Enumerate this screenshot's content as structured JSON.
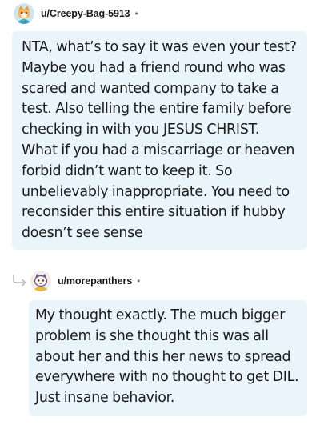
{
  "comments": [
    {
      "username": "u/Creepy-Bag-5913",
      "separator": "•",
      "avatar_icon": "avatar-fox-icon",
      "body": "NTA, what’s to say it was even your test? Maybe you had a friend round who was scared and wanted company to take a test. Also telling the entire family before checking in with you JESUS CHRIST. What if you had a miscarriage or heaven forbid didn’t want to keep it. So unbelievably inappropriate. You need to reconsider this entire situation if hubby doesn’t see sense"
    },
    {
      "username": "u/morepanthers",
      "separator": "•",
      "avatar_icon": "avatar-panther-icon",
      "reply_icon": "reply-arrow-icon",
      "body": "My thought exactly. The much bigger problem is she thought this was all about her and this her news to spread everywhere with no thought to get DIL. Just insane behavior."
    }
  ],
  "colors": {
    "bubble_bg": "#eaf4fb",
    "text": "#1c1c1c",
    "username": "#1a1a1b",
    "meta": "#7c7c7c"
  }
}
